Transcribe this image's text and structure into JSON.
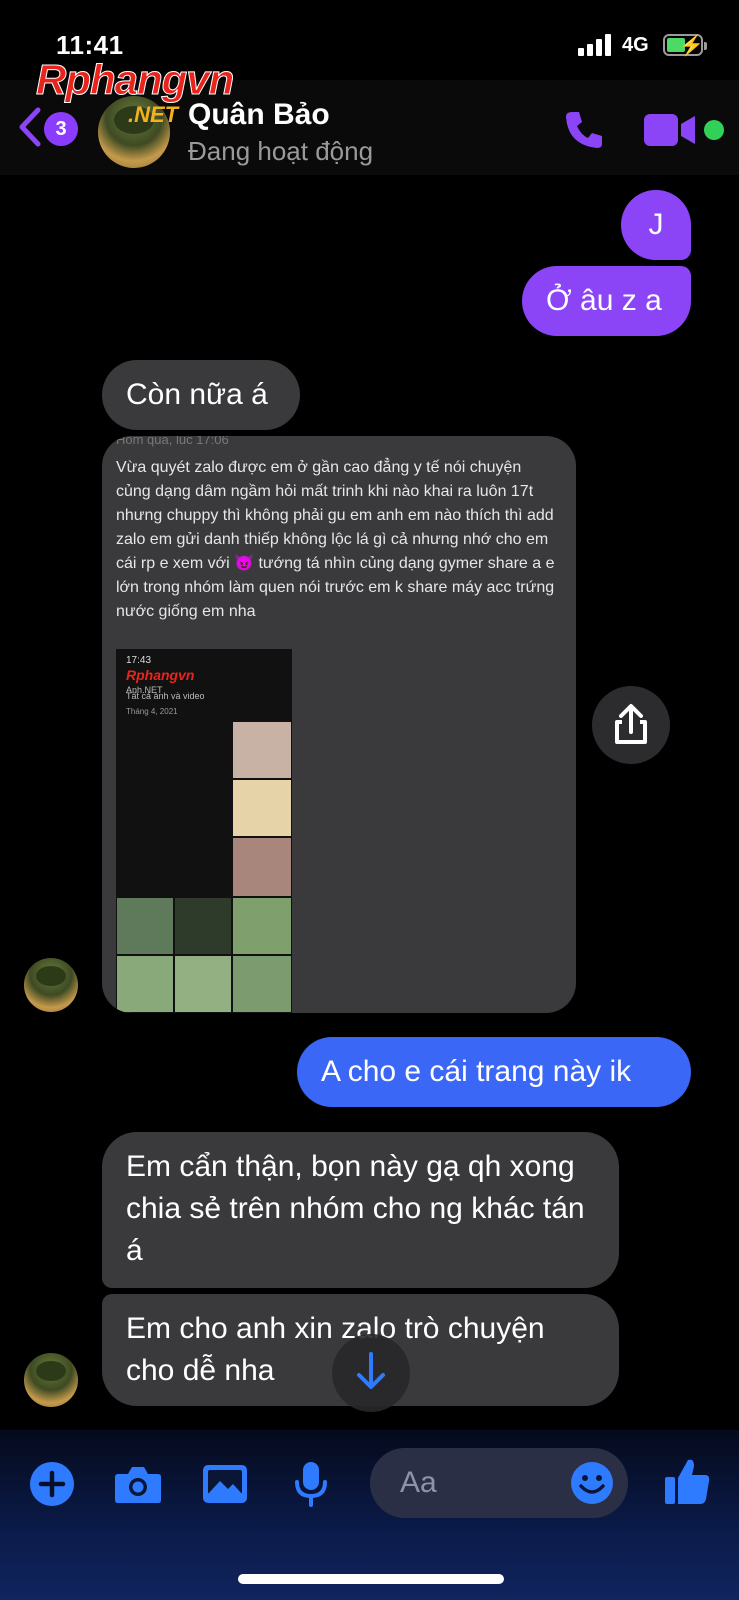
{
  "status_bar": {
    "time": "11:41",
    "network": "4G",
    "battery_state": "charging"
  },
  "watermark": {
    "brand": "Rphangvn",
    "suffix": ".NET"
  },
  "header": {
    "back_badge_count": "3",
    "contact_name": "Quân Bảo",
    "contact_status": "Đang hoạt động"
  },
  "messages": {
    "m1": "J",
    "m2": "Ở âu z a",
    "m3": "Còn nữa á",
    "shared_post": {
      "topline": "Hôm qua, lúc 17:06",
      "text": "Vừa quyét zalo được em ở gần cao đẳng y tế nói chuyện củng dạng dâm ngầm hỏi mất trinh khi nào khai ra luôn 17t nhưng chuppy thì không phải gu em anh em nào thích thì add zalo em gửi danh thiếp không lộc lá gì cả nhưng nhớ cho em cái rp e xem với 😈 tướng tá nhìn củng dạng gymer share a e lớn trong nhóm làm quen nói trước em k share máy acc trứng nước giống em nha",
      "screenshot": {
        "time": "17:43",
        "logo": "Rphangvn",
        "logo_sub": "Anh.NET",
        "caption": "Tất cả ảnh và video",
        "date": "Tháng 4, 2021"
      }
    },
    "m4": "A cho e cái trang này ik",
    "m5": "Em cẩn thận, bọn này gạ qh xong chia sẻ trên nhóm cho ng khác tán á",
    "m6": "Em cho anh xin zalo trò chuyện cho dễ nha"
  },
  "composer": {
    "placeholder": "Aa"
  },
  "colors": {
    "accent_purple": "#8b45f7",
    "accent_blue": "#3a67f5",
    "incoming_bubble": "#3a3a3c",
    "icon_blue": "#2f7bff",
    "active_green": "#31d158"
  },
  "icons": [
    "back-chevron-icon",
    "phone-icon",
    "video-camera-icon",
    "share-icon",
    "arrow-down-icon",
    "plus-icon",
    "camera-icon",
    "gallery-icon",
    "microphone-icon",
    "emoji-icon",
    "thumbs-up-icon"
  ]
}
